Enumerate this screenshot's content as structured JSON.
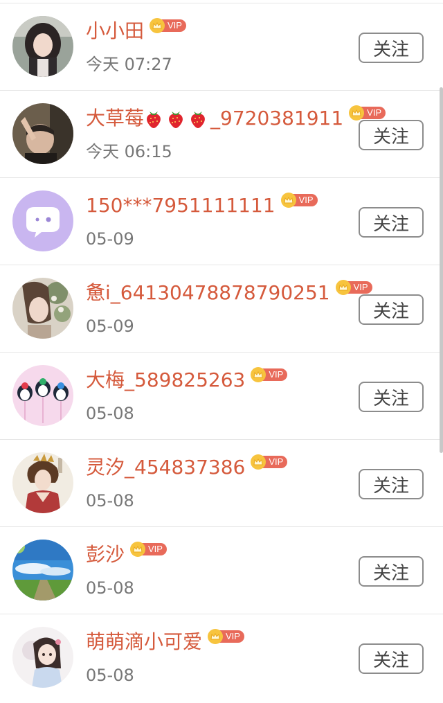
{
  "follow_label": "关注",
  "vip_label": "VIP",
  "colors": {
    "name": "#d55a3c",
    "vip_badge": "#e86a5a",
    "crown": "#f7c43e",
    "time": "#777777"
  },
  "users": [
    {
      "name": "小小田",
      "time": "今天 07:27",
      "vip": true,
      "avatar": "girl-photo"
    },
    {
      "name_prefix": "大草莓",
      "name_suffix": "_9720381911",
      "name_emoji_count": 3,
      "name_emoji": "strawberry-icon",
      "time": "今天 06:15",
      "vip": true,
      "avatar": "man-photo"
    },
    {
      "name": "150***7951111111",
      "time": "05-09",
      "vip": true,
      "avatar": "default-chat-avatar"
    },
    {
      "name": "惫i_64130478878790251",
      "time": "05-09",
      "vip": true,
      "avatar": "painted-girl-flowers"
    },
    {
      "name": "大梅_589825263",
      "time": "05-08",
      "vip": true,
      "avatar": "penguin-lollipops"
    },
    {
      "name": "灵汐_454837386",
      "time": "05-08",
      "vip": true,
      "avatar": "ancient-costume-lady"
    },
    {
      "name": "彭沙",
      "time": "05-08",
      "vip": true,
      "avatar": "sky-meadow-landscape"
    },
    {
      "name": "萌萌滴小可爱",
      "time": "05-08",
      "vip": true,
      "avatar": "cartoon-girl"
    }
  ]
}
